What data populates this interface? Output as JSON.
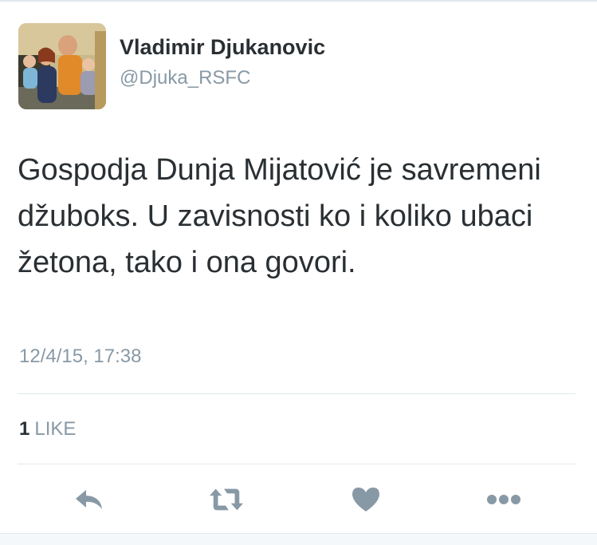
{
  "user": {
    "display_name": "Vladimir Djukanovic",
    "screen_name": "@Djuka_RSFC",
    "avatar_icon": "family-photo-avatar"
  },
  "tweet": {
    "text": "Gospodja Dunja Mijatović je savremeni džuboks. U zavisnosti ko i koliko ubaci žetona, tako i ona govori.",
    "timestamp": "12/4/15, 17:38"
  },
  "stats": {
    "likes_count": "1",
    "likes_label": "LIKE"
  },
  "actions": [
    {
      "name": "reply",
      "icon": "reply-icon"
    },
    {
      "name": "retweet",
      "icon": "retweet-icon"
    },
    {
      "name": "like",
      "icon": "heart-icon"
    },
    {
      "name": "more",
      "icon": "more-dots-icon"
    }
  ],
  "colors": {
    "text": "#292f33",
    "secondary": "#8899a6",
    "icon": "#8899a6",
    "divider": "#e1e8ed"
  }
}
